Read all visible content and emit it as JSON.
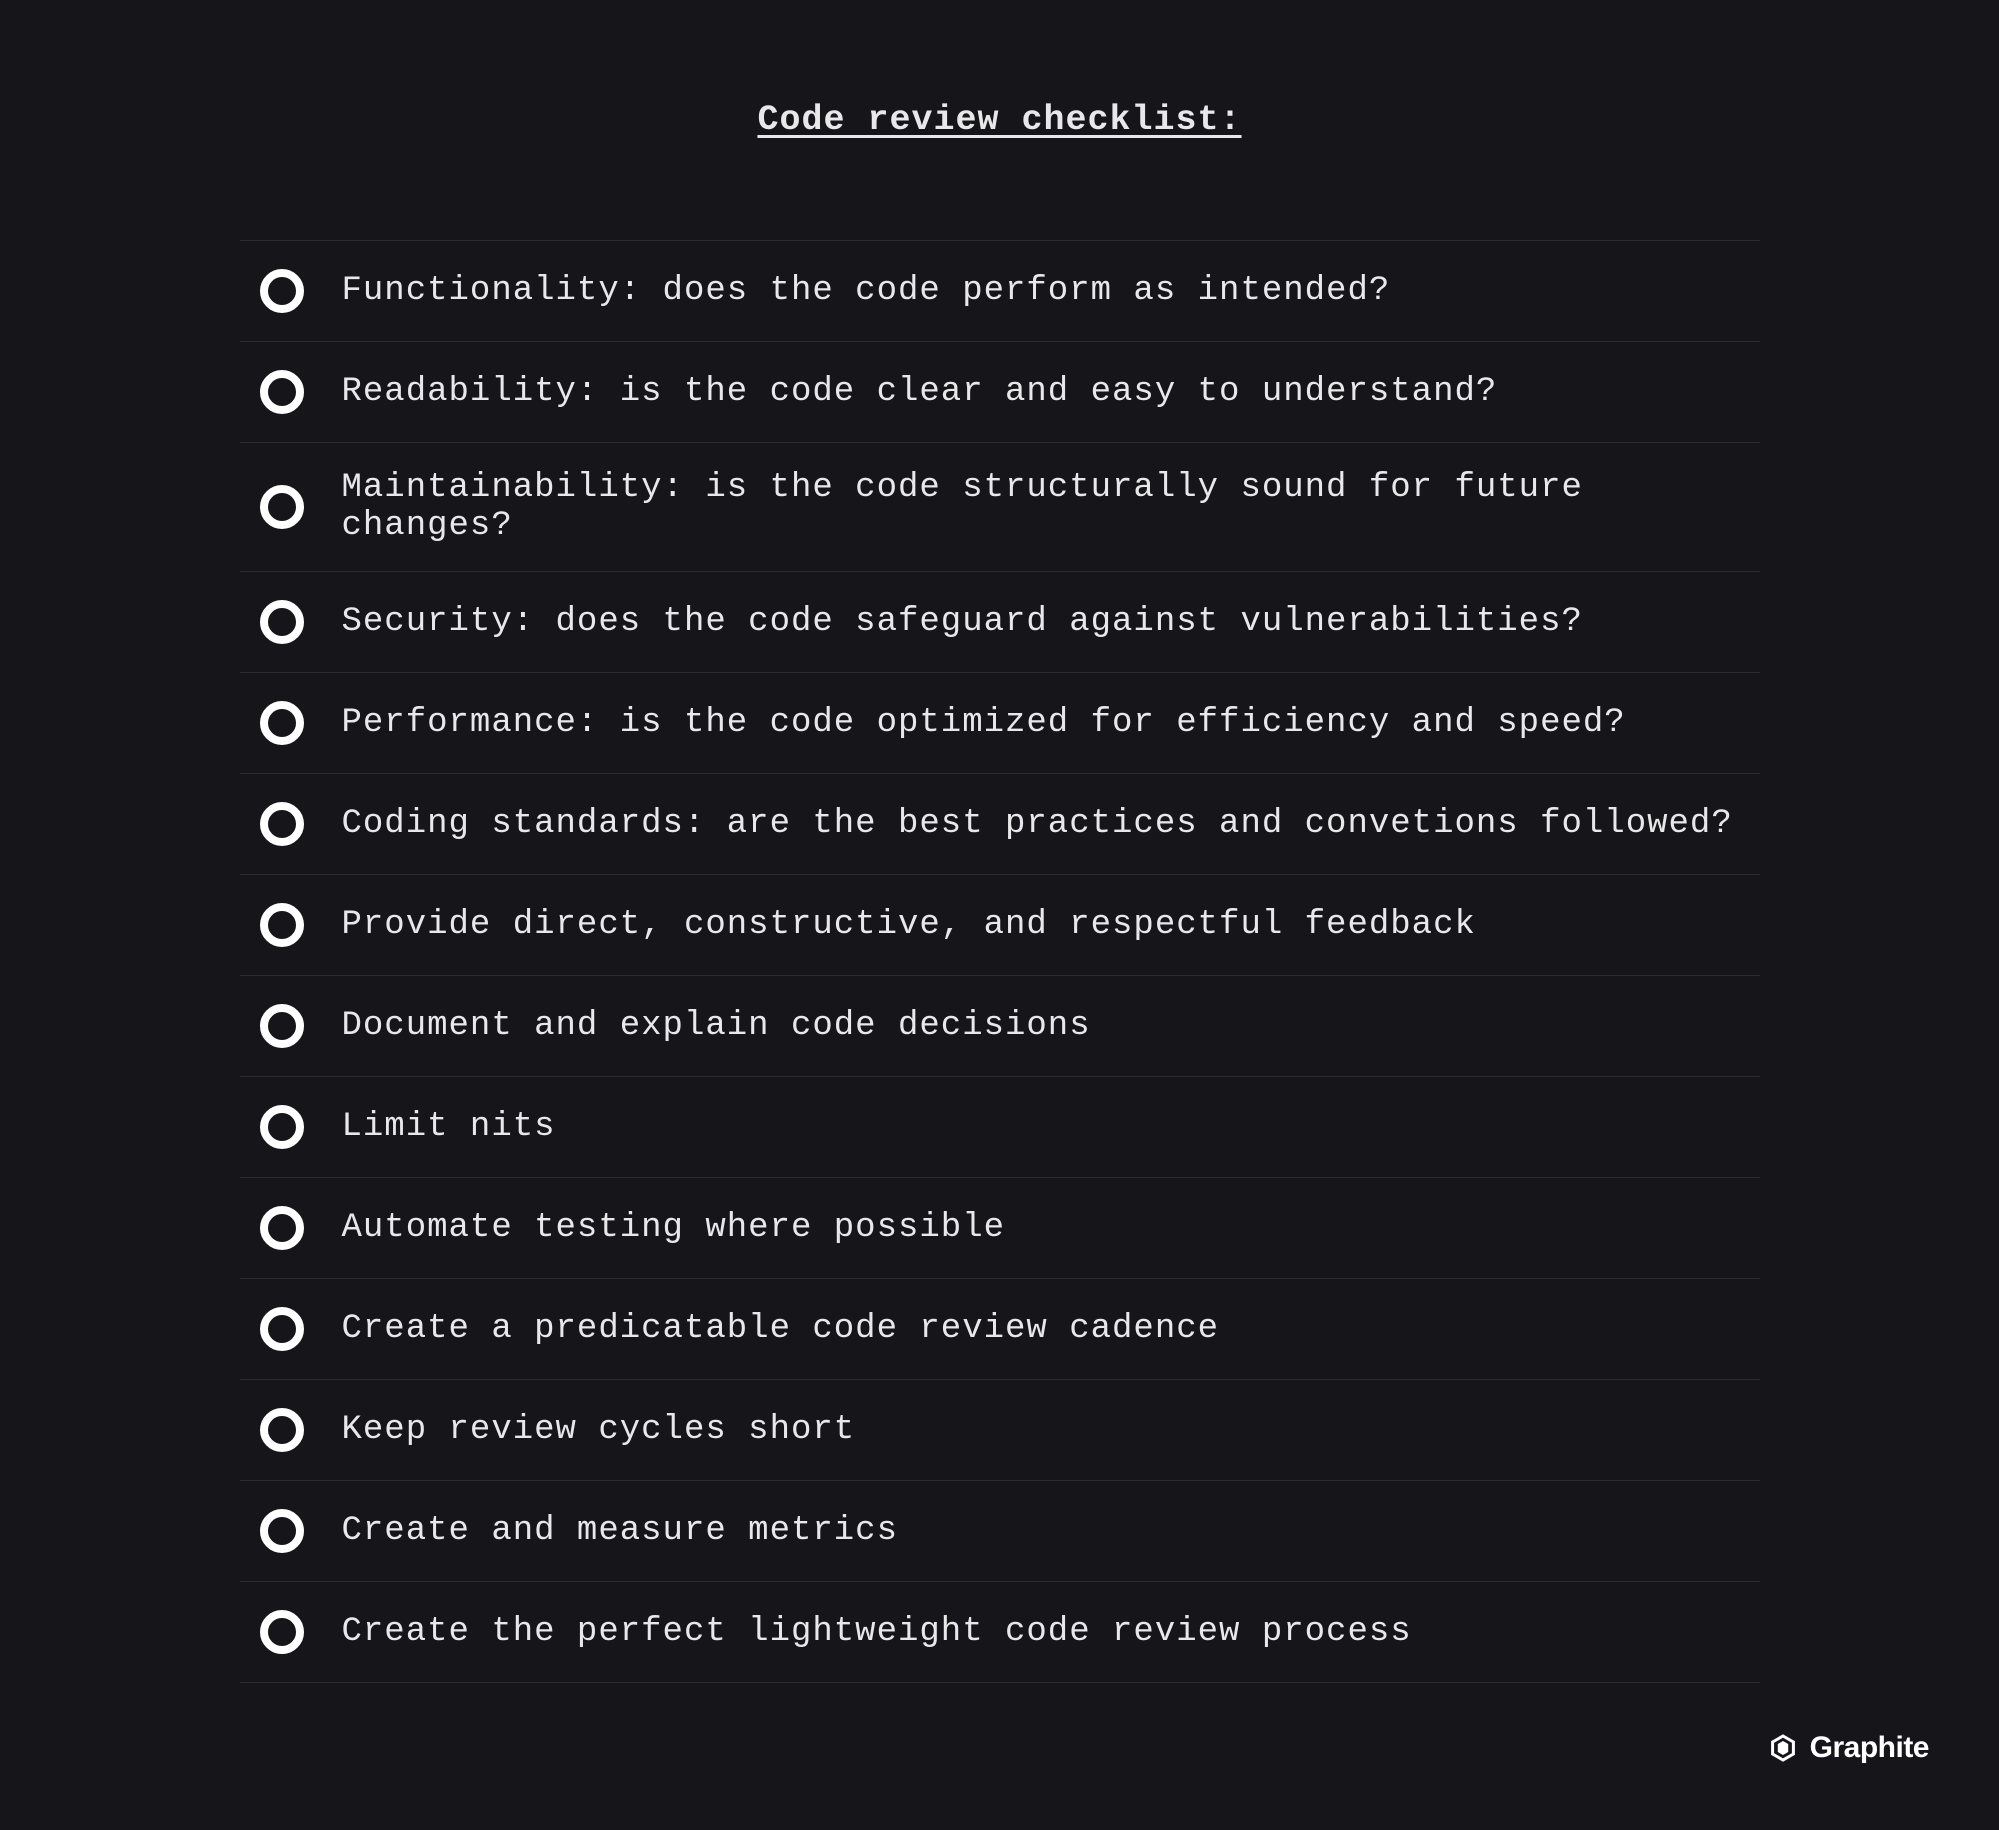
{
  "title": "Code review checklist:",
  "items": [
    "Functionality: does the code perform as intended?",
    "Readability: is the code clear and easy to understand?",
    "Maintainability: is the code structurally sound for future changes?",
    "Security: does the code safeguard against vulnerabilities?",
    "Performance: is the code optimized for efficiency and speed?",
    "Coding standards: are the best practices and convetions followed?",
    "Provide direct, constructive, and respectful feedback",
    "Document and explain code decisions",
    "Limit nits",
    "Automate testing where possible",
    "Create a predicatable code review cadence",
    "Keep review cycles short",
    "Create and measure metrics",
    "Create the perfect lightweight code review process"
  ],
  "footer": {
    "brand": "Graphite"
  }
}
